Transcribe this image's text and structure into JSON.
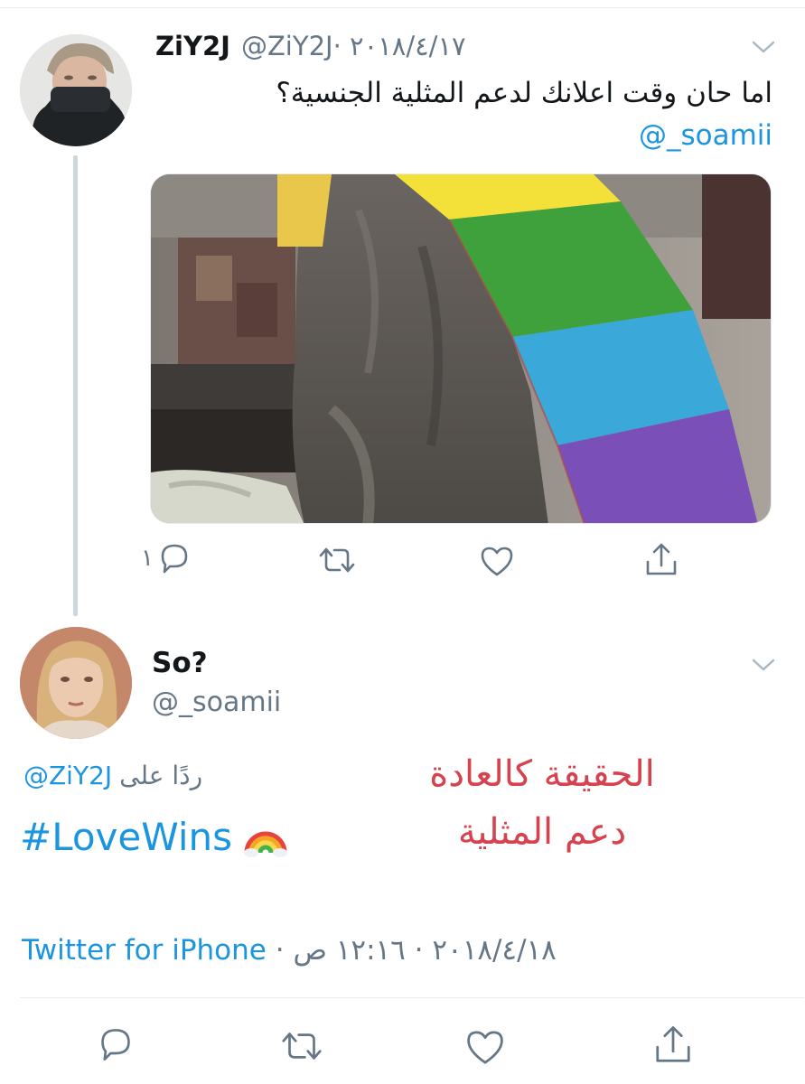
{
  "tweet": {
    "author_name": "ZiY2J",
    "author_handle": "@ZiY2J",
    "date": "· ٢٠١٨/٤/١٧",
    "text": "اما حان وقت اعلانك لدعم المثلية الجنسية؟",
    "mention": "@_soamii",
    "reply_count": "١",
    "actions": [
      "reply-icon",
      "retweet-icon",
      "like-icon",
      "share-icon"
    ]
  },
  "reply": {
    "author_name": "So?",
    "author_handle": "@_soamii",
    "reply_to_handle": "@ZiY2J",
    "reply_to_label": "ردًا على",
    "hashtag": "#LoveWins",
    "emoji": "rainbow-icon",
    "source": "Twitter for iPhone",
    "timestamp_rest": " · ٢٠١٨/٤/١٨ · ١٢:١٦ ص",
    "actions": [
      "reply-icon",
      "retweet-icon",
      "like-icon",
      "share-icon"
    ]
  },
  "overlay_caption": {
    "line1": "الحقيقة كالعادة",
    "line2": "دعم المثلية"
  },
  "colors": {
    "link_blue": "#1b95e0",
    "secondary_gray": "#657786",
    "overlay_red": "#d6424e"
  }
}
